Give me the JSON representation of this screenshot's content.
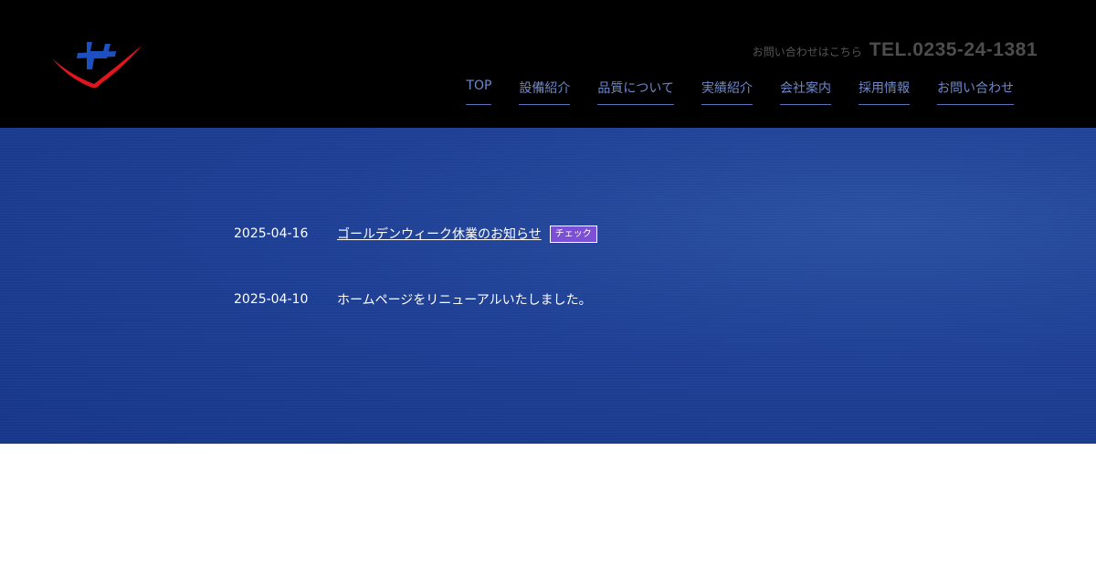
{
  "header": {
    "contact_label": "お問い合わせはこちら",
    "tel": "TEL.0235-24-1381"
  },
  "nav": {
    "items": [
      {
        "label": "TOP"
      },
      {
        "label": "設備紹介"
      },
      {
        "label": "品質について"
      },
      {
        "label": "実績紹介"
      },
      {
        "label": "会社案内"
      },
      {
        "label": "採用情報"
      },
      {
        "label": "お問い合わせ"
      }
    ]
  },
  "news": {
    "items": [
      {
        "date": "2025-04-16",
        "title": "ゴールデンウィーク休業のお知らせ",
        "badge": "チェック"
      },
      {
        "date": "2025-04-10",
        "title": "ホームページをリニューアルいたしました。"
      }
    ]
  },
  "colors": {
    "header_bg": "#000000",
    "nav_text": "#6e88c9",
    "hero_bg": "#1d3f95",
    "badge_bg": "#7b4fd6",
    "logo_red": "#e0161e",
    "logo_blue": "#1e4fc0"
  }
}
